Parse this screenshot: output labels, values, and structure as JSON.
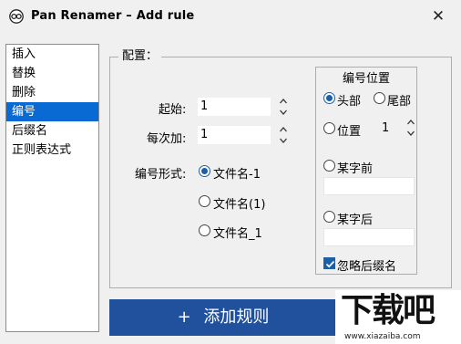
{
  "window": {
    "title": "Pan Renamer – Add rule",
    "close_symbol": "✕",
    "icon": "app-logo-icon"
  },
  "rule_list": {
    "items": [
      "插入",
      "替换",
      "删除",
      "编号",
      "后缀名",
      "正则表达式"
    ],
    "selected_index": 3
  },
  "config": {
    "group_title": "配置：",
    "start_label": "起始:",
    "start_value": "1",
    "step_label": "每次加:",
    "step_value": "1",
    "format_label": "编号形式:",
    "formats": [
      "文件名-1",
      "文件名(1)",
      "文件名_1"
    ],
    "selected_format": 0
  },
  "position": {
    "group_title": "编号位置",
    "head_label": "头部",
    "tail_label": "尾部",
    "position_label": "位置",
    "position_value": "1",
    "before_char_label": "某字前",
    "after_char_label": "某字后",
    "ignore_ext_label": "忽略后缀名",
    "ignore_ext_checked": true
  },
  "add_button": {
    "plus": "+",
    "label": "添加规则"
  },
  "watermark": {
    "text": "下载吧",
    "url": "www.xiazaiba.com"
  },
  "colors": {
    "selection": "#0a6ad4",
    "button": "#21509c",
    "radio_accent": "#1b5fa8"
  }
}
